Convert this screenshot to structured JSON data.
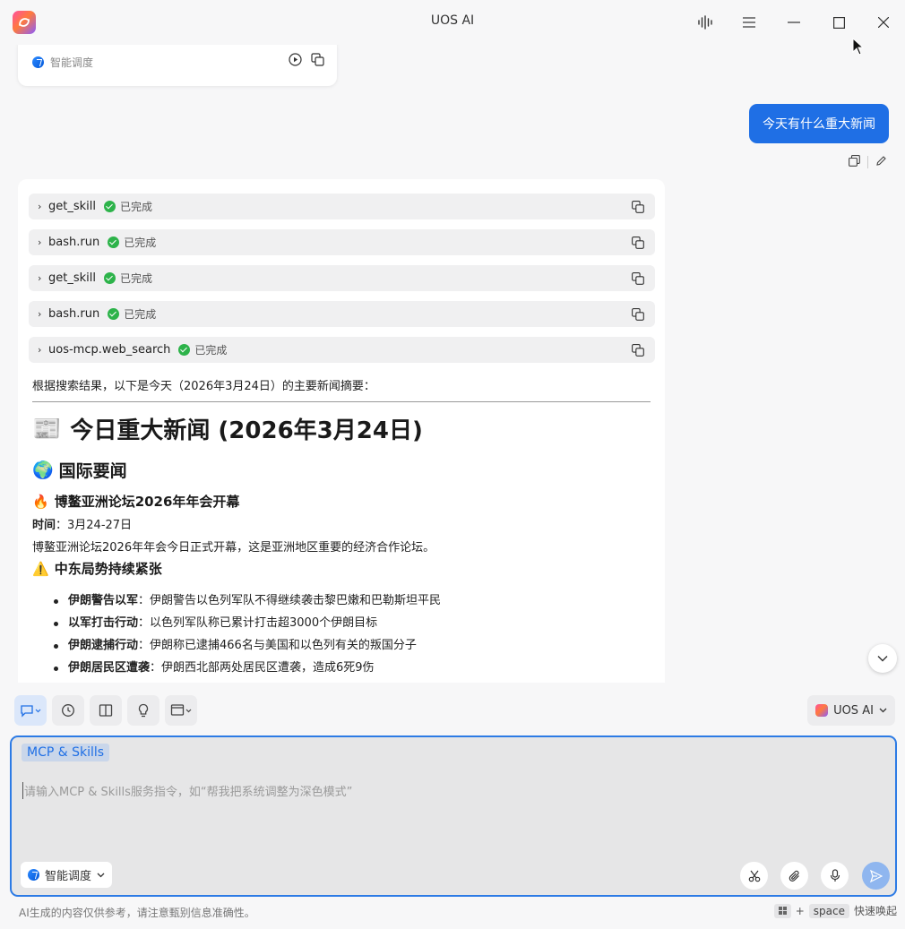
{
  "window": {
    "title": "UOS AI",
    "icons": [
      "voice-wave-icon",
      "menu-icon",
      "minimize-icon",
      "maximize-icon",
      "close-icon"
    ]
  },
  "previous_card": {
    "mode_label": "智能调度"
  },
  "user_message": {
    "text": "今天有什么重大新闻"
  },
  "tool_calls": [
    {
      "name": "get_skill",
      "status": "已完成"
    },
    {
      "name": "bash.run",
      "status": "已完成"
    },
    {
      "name": "get_skill",
      "status": "已完成"
    },
    {
      "name": "bash.run",
      "status": "已完成"
    },
    {
      "name": "uos-mcp.web_search",
      "status": "已完成"
    }
  ],
  "answer": {
    "intro": "根据搜索结果，以下是今天（2026年3月24日）的主要新闻摘要：",
    "h1_emoji": "📰",
    "h1": "今日重大新闻 (2026年3月24日)",
    "h2_emoji": "🌍",
    "h2": "国际要闻",
    "section1": {
      "emoji": "🔥",
      "title": "博鳌亚洲论坛2026年年会开幕",
      "time_label": "时间",
      "time_value": "：3月24-27日",
      "desc": "博鳌亚洲论坛2026年年会今日正式开幕，这是亚洲地区重要的经济合作论坛。"
    },
    "section2": {
      "emoji": "⚠️",
      "title": "中东局势持续紧张",
      "bullets": [
        {
          "bold": "伊朗警告以军",
          "text": "：伊朗警告以色列军队不得继续袭击黎巴嫩和巴勒斯坦平民"
        },
        {
          "bold": "以军打击行动",
          "text": "：以色列军队称已累计打击超3000个伊朗目标"
        },
        {
          "bold": "伊朗逮捕行动",
          "text": "：伊朗称已逮捕466名与美国和以色列有关的叛国分子"
        },
        {
          "bold": "伊朗居民区遭袭",
          "text": "：伊朗西北部两处居民区遭袭，造成6死9伤"
        }
      ]
    }
  },
  "toolbar": {
    "model_label": "UOS AI"
  },
  "input": {
    "tag": "MCP & Skills",
    "placeholder": "请输入MCP & Skills服务指令，如“帮我把系统调整为深色模式”",
    "mode_label": "智能调度"
  },
  "footer": {
    "disclaimer": "AI生成的内容仅供参考，请注意甄别信息准确性。",
    "hotkey_plus": "+",
    "hotkey_key": "space",
    "hotkey_label": "快速唤起"
  }
}
